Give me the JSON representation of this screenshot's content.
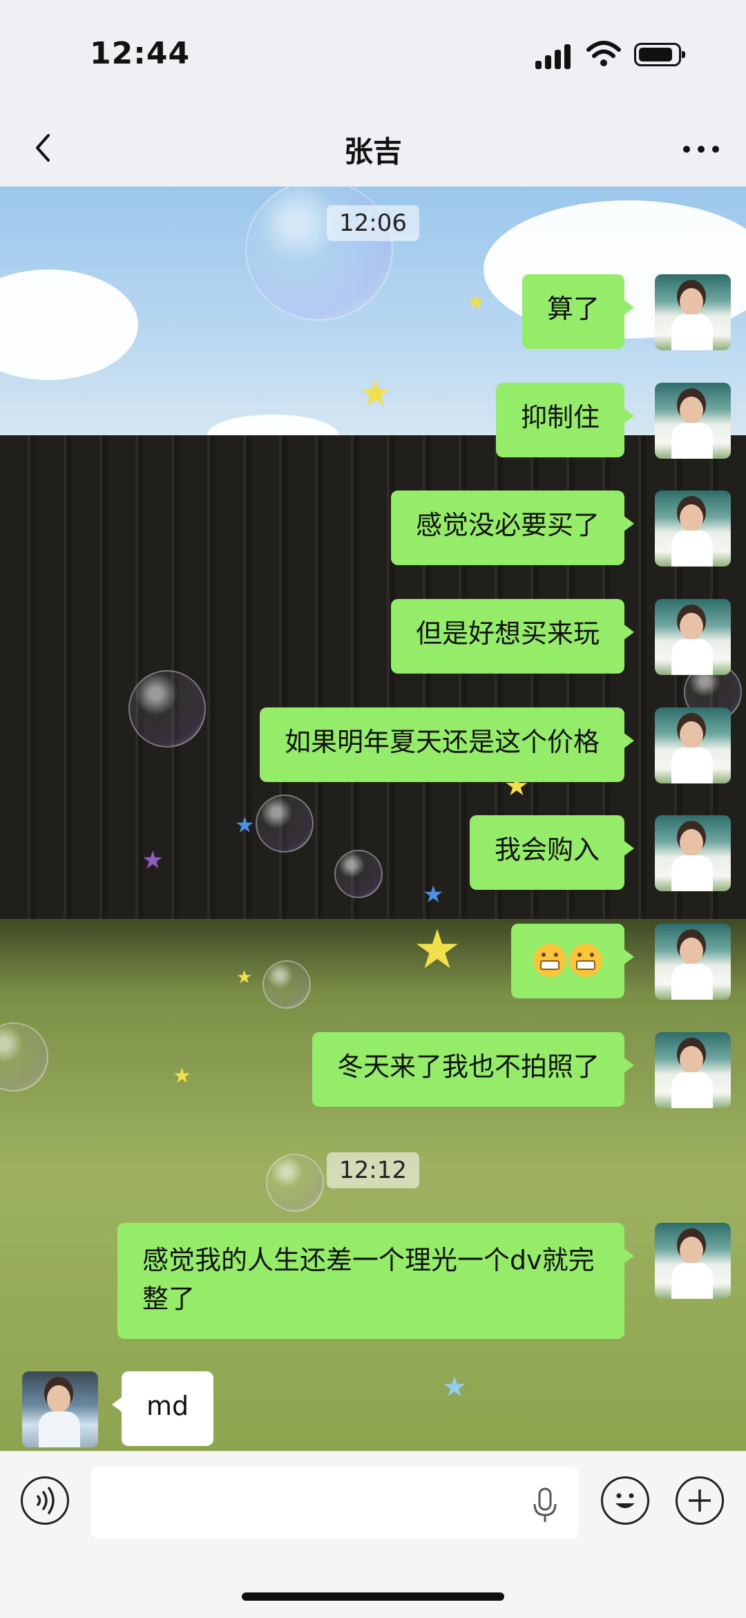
{
  "status_bar": {
    "time": "12:44"
  },
  "nav": {
    "title": "张吉",
    "back_icon": "chevron-left-icon",
    "more_icon": "more-dots-icon"
  },
  "messages": [
    {
      "type": "time",
      "text": "12:06"
    },
    {
      "type": "out",
      "text": "算了"
    },
    {
      "type": "out",
      "text": "抑制住"
    },
    {
      "type": "out",
      "text": "感觉没必要买了"
    },
    {
      "type": "out",
      "text": "但是好想买来玩"
    },
    {
      "type": "out",
      "text": "如果明年夏天还是这个价格"
    },
    {
      "type": "out",
      "text": "我会购入"
    },
    {
      "type": "out",
      "text": "😬😬",
      "emoji_name": "grimacing-face-emoji"
    },
    {
      "type": "out",
      "text": "冬天来了我也不拍照了"
    },
    {
      "type": "time",
      "text": "12:12"
    },
    {
      "type": "out",
      "text": "感觉我的人生还差一个理光一个dv就完整了"
    },
    {
      "type": "in",
      "text": "md"
    }
  ],
  "input_bar": {
    "voice_icon": "voice-icon",
    "mic_icon": "microphone-icon",
    "emoji_icon": "smiley-icon",
    "plus_icon": "plus-icon"
  },
  "colors": {
    "outgoing_bubble": "#95ec69",
    "incoming_bubble": "#ffffff"
  }
}
